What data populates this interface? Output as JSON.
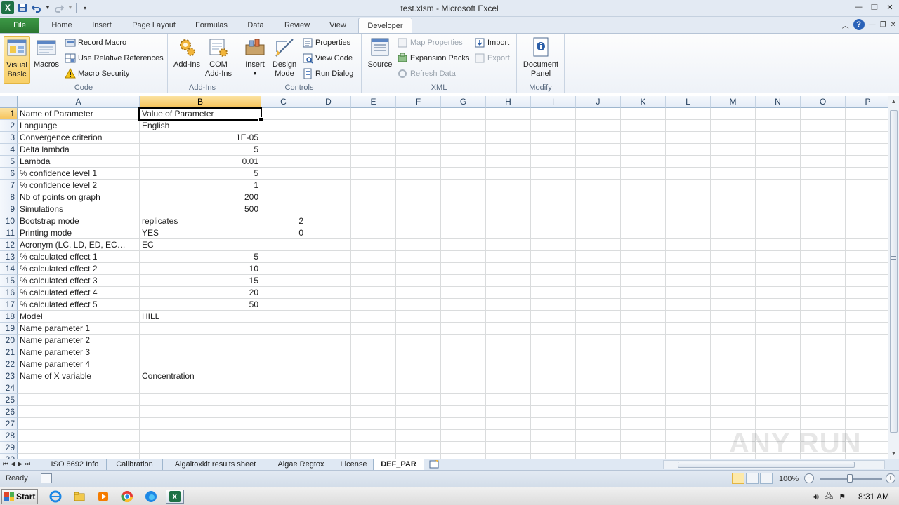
{
  "window": {
    "title": "test.xlsm  -  Microsoft Excel",
    "app_icon_letter": "X"
  },
  "ribbon_tabs": [
    {
      "label": "File"
    },
    {
      "label": "Home"
    },
    {
      "label": "Insert"
    },
    {
      "label": "Page Layout"
    },
    {
      "label": "Formulas"
    },
    {
      "label": "Data"
    },
    {
      "label": "Review"
    },
    {
      "label": "View"
    },
    {
      "label": "Developer"
    }
  ],
  "ribbon": {
    "code": {
      "label": "Code",
      "visual_basic": "Visual Basic",
      "visual_basic_line1": "Visual",
      "visual_basic_line2": "Basic",
      "macros": "Macros",
      "record_macro": "Record Macro",
      "use_relative_references": "Use Relative References",
      "macro_security": "Macro Security"
    },
    "addins": {
      "label": "Add-Ins",
      "add_ins": "Add-Ins",
      "com_line1": "COM",
      "com_line2": "Add-Ins"
    },
    "controls": {
      "label": "Controls",
      "insert": "Insert",
      "design_line1": "Design",
      "design_line2": "Mode",
      "properties": "Properties",
      "view_code": "View Code",
      "run_dialog": "Run Dialog"
    },
    "xml": {
      "label": "XML",
      "source": "Source",
      "map_properties": "Map Properties",
      "expansion_packs": "Expansion Packs",
      "refresh_data": "Refresh Data",
      "import": "Import",
      "export": "Export"
    },
    "modify": {
      "label": "Modify",
      "doc_line1": "Document",
      "doc_line2": "Panel"
    }
  },
  "columns": [
    "A",
    "B",
    "C",
    "D",
    "E",
    "F",
    "G",
    "H",
    "I",
    "J",
    "K",
    "L",
    "M",
    "N",
    "O",
    "P"
  ],
  "rows": [
    {
      "n": "1",
      "a": "Name of Parameter",
      "b": "Value of Parameter",
      "c": ""
    },
    {
      "n": "2",
      "a": "Language",
      "b": "English",
      "c": ""
    },
    {
      "n": "3",
      "a": "Convergence criterion",
      "b": "1E-05",
      "c": ""
    },
    {
      "n": "4",
      "a": "Delta lambda",
      "b": "5",
      "c": ""
    },
    {
      "n": "5",
      "a": "Lambda",
      "b": "0.01",
      "c": ""
    },
    {
      "n": "6",
      "a": "% confidence level 1",
      "b": "5",
      "c": ""
    },
    {
      "n": "7",
      "a": "% confidence level 2",
      "b": "1",
      "c": ""
    },
    {
      "n": "8",
      "a": "Nb of points on graph",
      "b": "200",
      "c": ""
    },
    {
      "n": "9",
      "a": "Simulations",
      "b": "500",
      "c": ""
    },
    {
      "n": "10",
      "a": "Bootstrap mode",
      "b": "replicates",
      "c": "2"
    },
    {
      "n": "11",
      "a": "Printing mode",
      "b": "YES",
      "c": "0"
    },
    {
      "n": "12",
      "a": "Acronym (LC, LD, ED, EC…",
      "b": "EC",
      "c": ""
    },
    {
      "n": "13",
      "a": "% calculated effect 1",
      "b": "5",
      "c": ""
    },
    {
      "n": "14",
      "a": "% calculated effect 2",
      "b": "10",
      "c": ""
    },
    {
      "n": "15",
      "a": "% calculated effect 3",
      "b": "15",
      "c": ""
    },
    {
      "n": "16",
      "a": "% calculated effect 4",
      "b": "20",
      "c": ""
    },
    {
      "n": "17",
      "a": "% calculated effect 5",
      "b": "50",
      "c": ""
    },
    {
      "n": "18",
      "a": "Model",
      "b": "HILL",
      "c": ""
    },
    {
      "n": "19",
      "a": "Name parameter 1",
      "b": "",
      "c": ""
    },
    {
      "n": "20",
      "a": "Name parameter 2",
      "b": "",
      "c": ""
    },
    {
      "n": "21",
      "a": "Name parameter 3",
      "b": "",
      "c": ""
    },
    {
      "n": "22",
      "a": "Name parameter 4",
      "b": "",
      "c": ""
    },
    {
      "n": "23",
      "a": "Name of X variable",
      "b": "Concentration",
      "c": ""
    },
    {
      "n": "24",
      "a": "",
      "b": "",
      "c": ""
    },
    {
      "n": "25",
      "a": "",
      "b": "",
      "c": ""
    },
    {
      "n": "26",
      "a": "",
      "b": "",
      "c": ""
    },
    {
      "n": "27",
      "a": "",
      "b": "",
      "c": ""
    },
    {
      "n": "28",
      "a": "",
      "b": "",
      "c": ""
    },
    {
      "n": "29",
      "a": "",
      "b": "",
      "c": ""
    },
    {
      "n": "30",
      "a": "",
      "b": "",
      "c": ""
    }
  ],
  "numeric_b_rows": [
    "3",
    "4",
    "5",
    "6",
    "7",
    "8",
    "9",
    "13",
    "14",
    "15",
    "16",
    "17"
  ],
  "selected_cell": "B1",
  "sheet_tabs": [
    {
      "label": "ISO 8692 Info"
    },
    {
      "label": "Calibration"
    },
    {
      "label": "Algaltoxkit results sheet"
    },
    {
      "label": "Algae Regtox"
    },
    {
      "label": "License"
    },
    {
      "label": "DEF_PAR"
    }
  ],
  "active_sheet": "DEF_PAR",
  "status": {
    "mode": "Ready",
    "zoom": "100%",
    "zoom_minus": "−",
    "zoom_plus": "+"
  },
  "taskbar": {
    "start": "Start",
    "clock": "8:31 AM"
  },
  "watermark": "ANY  RUN",
  "colors": {
    "excel_green": "#1e7145",
    "file_tab": "#2a7631",
    "selection_header": "#f6c35a",
    "grid_line": "#dadcdd"
  }
}
